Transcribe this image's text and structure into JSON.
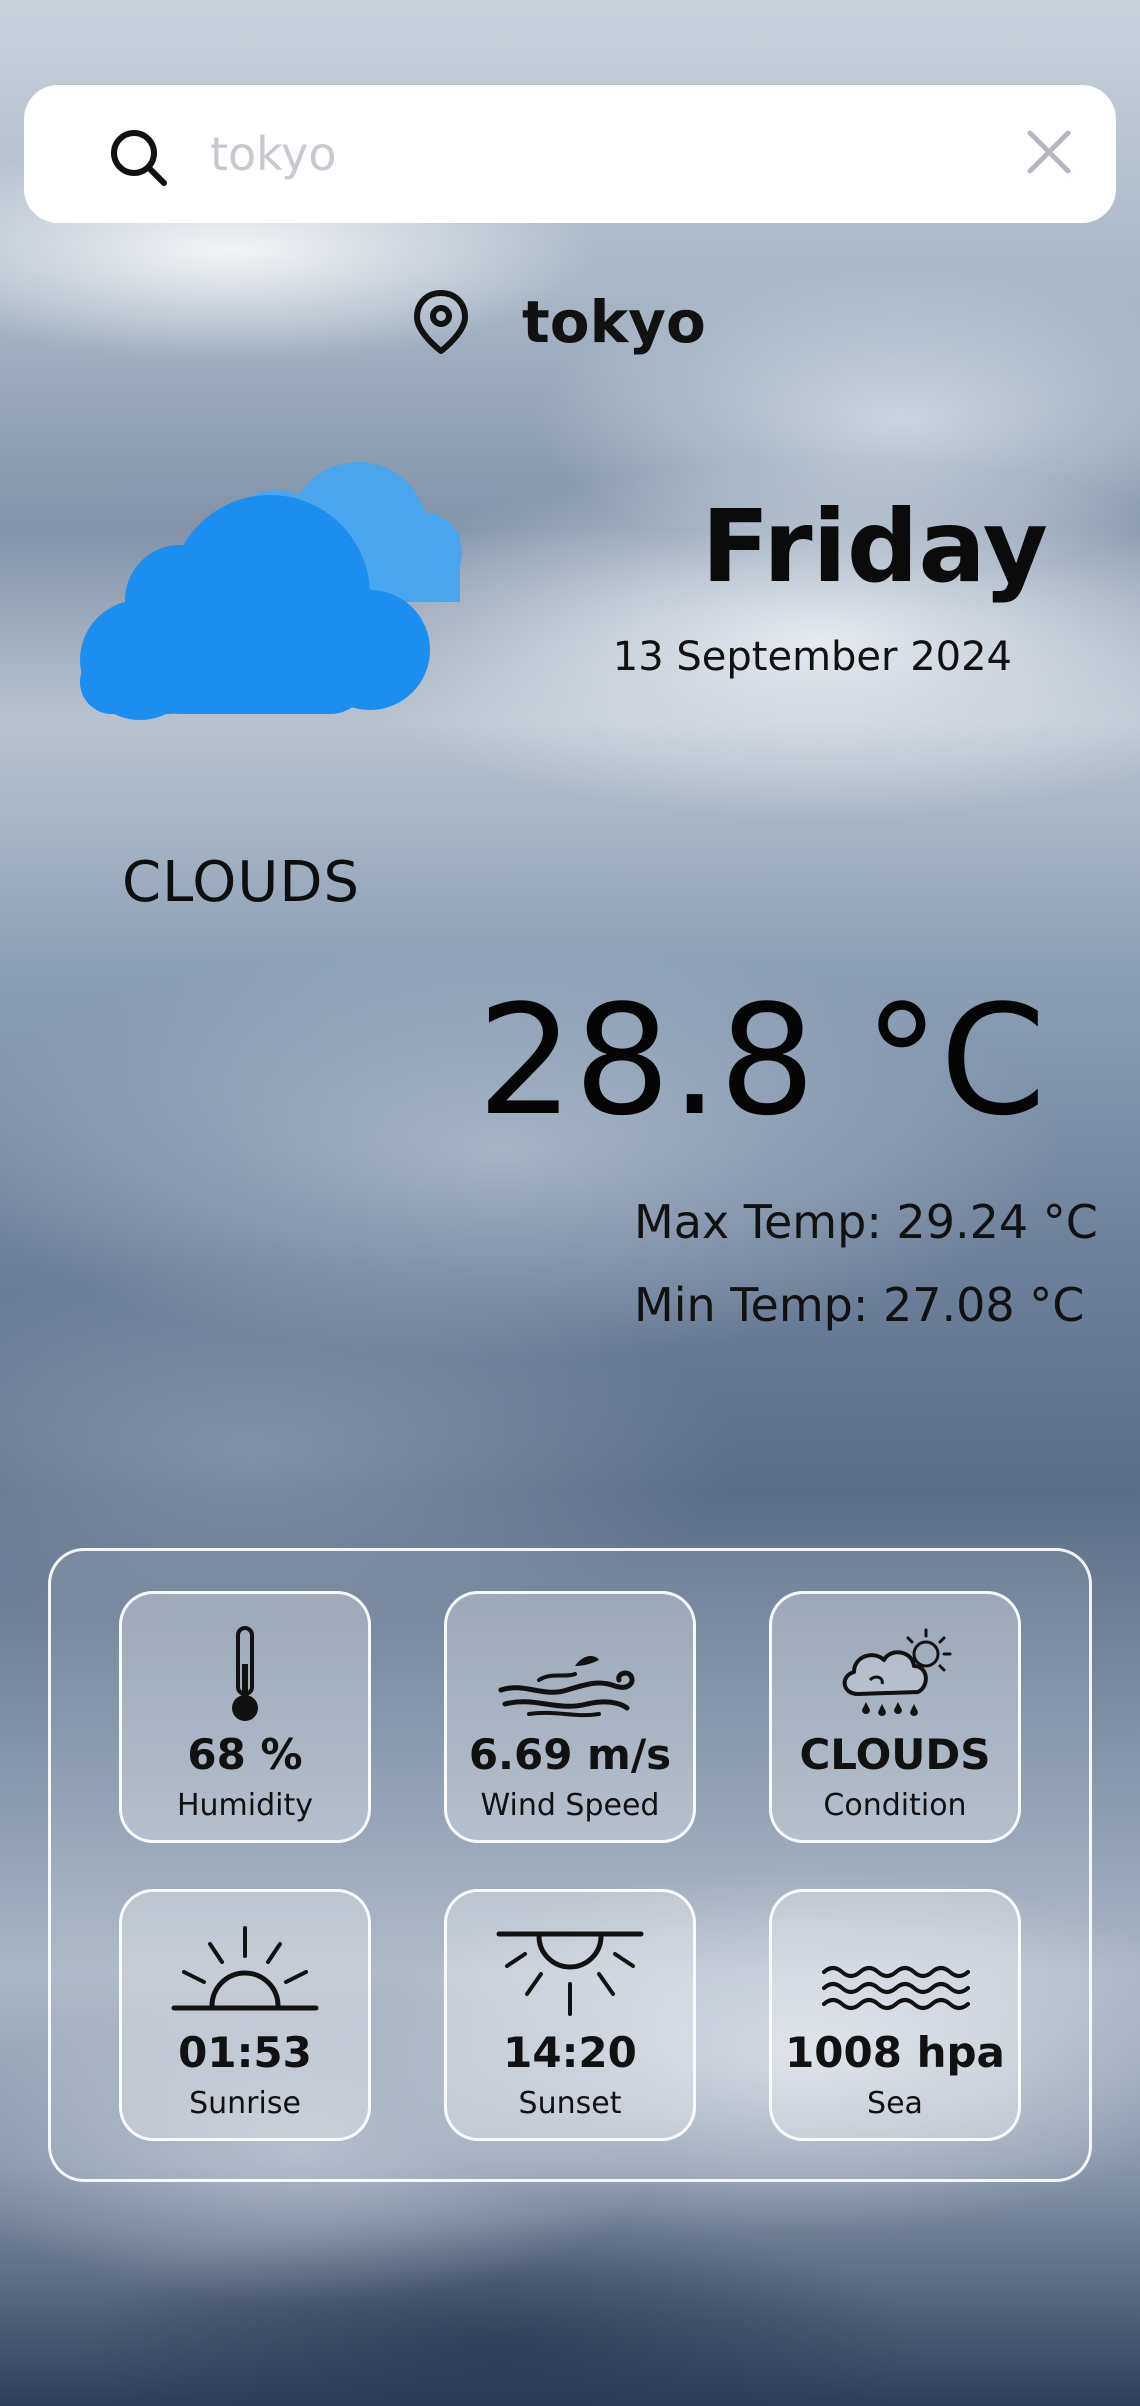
{
  "search": {
    "placeholder": "tokyo",
    "value": ""
  },
  "location": {
    "name": "tokyo"
  },
  "weather": {
    "day": "Friday",
    "date": "13 September 2024",
    "condition": "CLOUDS",
    "temperature": "28.8 °C",
    "max_temp": "Max Temp: 29.24 °C",
    "min_temp": "Min Temp: 27.08 °C"
  },
  "details": [
    {
      "value": "68 %",
      "label": "Humidity",
      "icon": "thermometer-icon"
    },
    {
      "value": "6.69 m/s",
      "label": "Wind Speed",
      "icon": "wind-icon"
    },
    {
      "value": "CLOUDS",
      "label": "Condition",
      "icon": "cloud-rain-sun-icon"
    },
    {
      "value": "01:53",
      "label": "Sunrise",
      "icon": "sunrise-icon"
    },
    {
      "value": "14:20",
      "label": "Sunset",
      "icon": "sunset-icon"
    },
    {
      "value": "1008 hpa",
      "label": "Sea",
      "icon": "waves-icon"
    }
  ],
  "colors": {
    "cloud_primary": "#1b8ef0",
    "cloud_secondary": "#4aa6ec",
    "panel_border": "#ffffff"
  }
}
